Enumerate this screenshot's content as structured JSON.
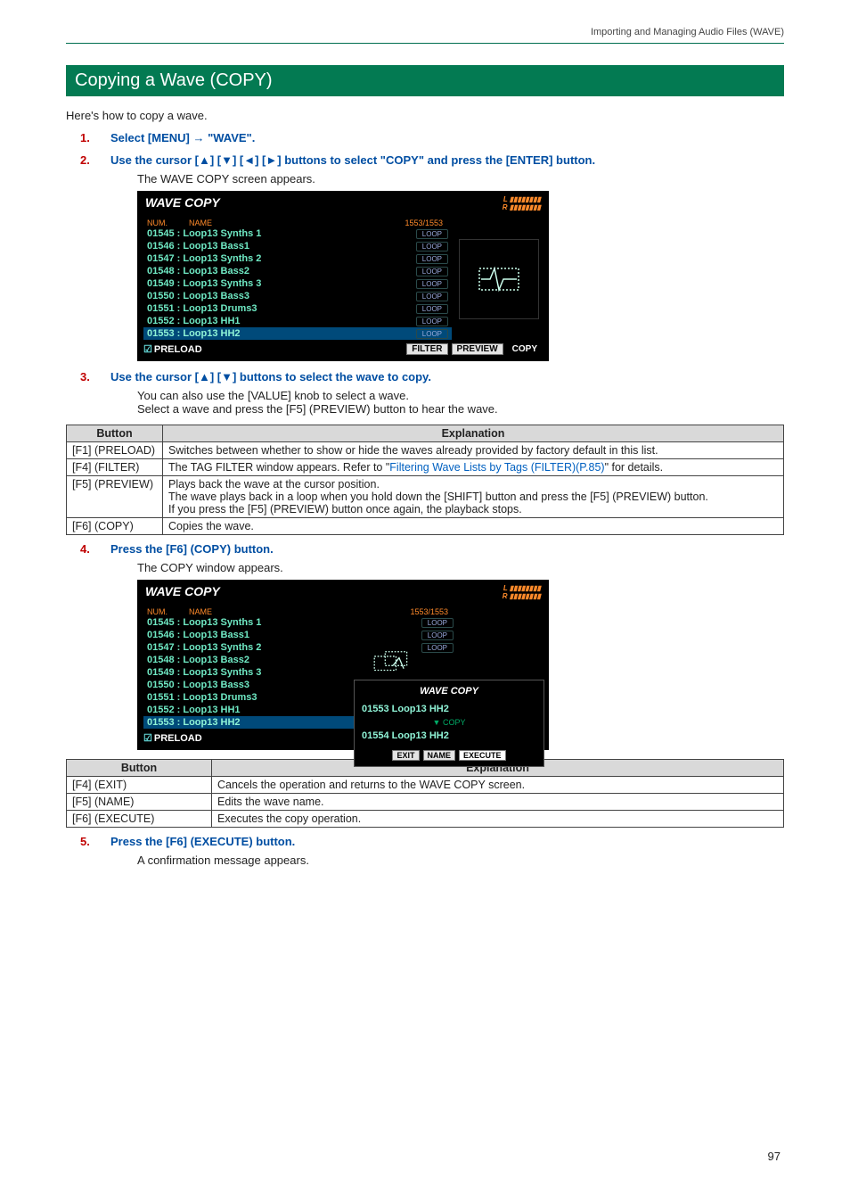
{
  "header": {
    "breadcrumb": "Importing and Managing Audio Files (WAVE)"
  },
  "section": {
    "title": "Copying a Wave (COPY)",
    "intro": "Here's how to copy a wave."
  },
  "steps": [
    {
      "num": "1.",
      "head": "Select [MENU] → \"WAVE\".",
      "body": []
    },
    {
      "num": "2.",
      "head": "Use the cursor [▲] [▼] [◄] [►] buttons to select \"COPY\" and press the [ENTER] button.",
      "body": [
        "The WAVE COPY screen appears."
      ]
    },
    {
      "num": "3.",
      "head": "Use the cursor [▲] [▼] buttons to select the wave to copy.",
      "body": [
        "You can also use the [VALUE] knob to select a wave.",
        "Select a wave and press the [F5] (PREVIEW) button to hear the wave."
      ]
    },
    {
      "num": "4.",
      "head": "Press the [F6] (COPY) button.",
      "body": [
        "The COPY window appears."
      ]
    },
    {
      "num": "5.",
      "head": "Press the [F6] (EXECUTE) button.",
      "body": [
        "A confirmation message appears."
      ]
    }
  ],
  "screen1": {
    "title": "WAVE COPY",
    "counter": "1553/1553",
    "hdr_num": "NUM.",
    "hdr_name": "NAME",
    "rows": [
      {
        "label": "01545 : Loop13 Synths 1",
        "tag": "LOOP",
        "sel": false
      },
      {
        "label": "01546 : Loop13 Bass1",
        "tag": "LOOP",
        "sel": false
      },
      {
        "label": "01547 : Loop13 Synths 2",
        "tag": "LOOP",
        "sel": false
      },
      {
        "label": "01548 : Loop13 Bass2",
        "tag": "LOOP",
        "sel": false
      },
      {
        "label": "01549 : Loop13 Synths 3",
        "tag": "LOOP",
        "sel": false
      },
      {
        "label": "01550 : Loop13 Bass3",
        "tag": "LOOP",
        "sel": false
      },
      {
        "label": "01551 : Loop13 Drums3",
        "tag": "LOOP",
        "sel": false
      },
      {
        "label": "01552 : Loop13 HH1",
        "tag": "LOOP",
        "sel": false
      },
      {
        "label": "01553 : Loop13 HH2",
        "tag": "LOOP",
        "sel": true
      }
    ],
    "preload": "PRELOAD",
    "buttons": [
      "FILTER",
      "PREVIEW",
      "COPY"
    ]
  },
  "screen2": {
    "title": "WAVE COPY",
    "counter": "1553/1553",
    "hdr_num": "NUM.",
    "hdr_name": "NAME",
    "rows": [
      {
        "label": "01545 : Loop13 Synths 1",
        "tag": "LOOP",
        "sel": false
      },
      {
        "label": "01546 : Loop13 Bass1",
        "tag": "LOOP",
        "sel": false
      },
      {
        "label": "01547 : Loop13 Synths 2",
        "tag": "LOOP",
        "sel": false
      },
      {
        "label": "01548 : Loop13 Bass2",
        "tag": "",
        "sel": false
      },
      {
        "label": "01549 : Loop13 Synths 3",
        "tag": "",
        "sel": false
      },
      {
        "label": "01550 : Loop13 Bass3",
        "tag": "",
        "sel": false
      },
      {
        "label": "01551 : Loop13 Drums3",
        "tag": "",
        "sel": false
      },
      {
        "label": "01552 : Loop13 HH1",
        "tag": "",
        "sel": false
      },
      {
        "label": "01553 : Loop13 HH2",
        "tag": "",
        "sel": true
      }
    ],
    "preload": "PRELOAD",
    "popup": {
      "title": "WAVE COPY",
      "src": "01553 Loop13 HH2",
      "arrow": "COPY",
      "dst": "01554 Loop13 HH2",
      "buttons": [
        "EXIT",
        "NAME",
        "EXECUTE"
      ]
    }
  },
  "table1": {
    "head": [
      "Button",
      "Explanation"
    ],
    "rows": [
      [
        "[F1] (PRELOAD)",
        "Switches between whether to show or hide the waves already provided by factory default in this list."
      ],
      [
        "[F4] (FILTER)",
        "The TAG FILTER window appears. Refer to \"Filtering Wave Lists by Tags (FILTER)(P.85)\" for details."
      ],
      [
        "[F5] (PREVIEW)",
        "Plays back the wave at the cursor position.\nThe wave plays back in a loop when you hold down the [SHIFT] button and press the [F5] (PREVIEW) button.\nIf you press the [F5] (PREVIEW) button once again, the playback stops."
      ],
      [
        "[F6] (COPY)",
        "Copies the wave."
      ]
    ],
    "link_text": "Filtering Wave Lists by Tags (FILTER)(P.85)"
  },
  "table2": {
    "head": [
      "Button",
      "Explanation"
    ],
    "rows": [
      [
        "[F4] (EXIT)",
        "Cancels the operation and returns to the WAVE COPY screen."
      ],
      [
        "[F5] (NAME)",
        "Edits the wave name."
      ],
      [
        "[F6] (EXECUTE)",
        "Executes the copy operation."
      ]
    ]
  },
  "page_number": "97"
}
